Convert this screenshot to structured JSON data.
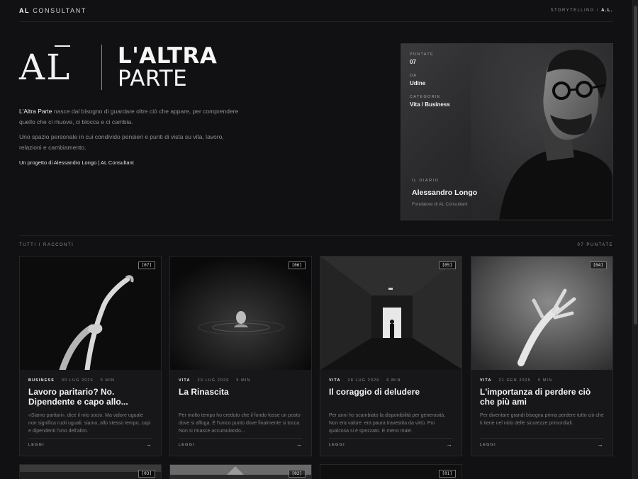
{
  "topbar": {
    "brand_bold": "AL",
    "brand_rest": "CONSULTANT",
    "nav_link": "STORYTELLING",
    "nav_separator": "/",
    "nav_current": "A.L."
  },
  "hero": {
    "logo_mark": "AL",
    "title_line1": "L'ALTRA",
    "title_line2": "PARTE",
    "intro_strong": "L'Altra Parte",
    "intro_rest": " nasce dal bisogno di guardare oltre ciò che appare, per comprendere quello che ci muove, ci blocca e ci cambia.",
    "intro_p2": "Uno spazio personale in cui condivido pensieri e punti di vista su vita, lavoro, relazioni e cambiamento.",
    "credit": "Un progetto di Alessandro Longo | AL Consultant"
  },
  "profile": {
    "episodes_label": "PUNTATE",
    "episodes_value": "07",
    "from_label": "DA",
    "from_value": "Udine",
    "categories_label": "CATEGORIE",
    "categories_value": "Vita / Business",
    "diary_label": "IL DIARIO",
    "name": "Alessandro Longo",
    "role": "Fondatore di AL Consultant"
  },
  "section": {
    "title": "TUTTI I RACCONTI",
    "count": "07 PUNTATE"
  },
  "cards": [
    {
      "badge": "[07]",
      "category": "BUSINESS",
      "date": "30 LUG 2026",
      "read": "5 MIN",
      "title": "Lavoro paritario? No. Dipendente e capo allo...",
      "excerpt": "«Siamo paritari», dice il mio socio. Ma valore uguale non significa ruoli uguali: siamo, allo stesso tempo, capi e dipendenti l'uno dell'altro.",
      "cta": "LEGGI",
      "arrow": "→"
    },
    {
      "badge": "[06]",
      "category": "VITA",
      "date": "29 LUG 2026",
      "read": "5 MIN",
      "title": "La Rinascita",
      "excerpt": "Per molto tempo ho creduto che il fondo fosse un posto dove si affoga. È l'unico punto dove finalmente si tocca. Non si rinasce accumulando...",
      "cta": "LEGGI",
      "arrow": "→"
    },
    {
      "badge": "[05]",
      "category": "VITA",
      "date": "28 LUG 2026",
      "read": "6 MIN",
      "title": "Il coraggio di deludere",
      "excerpt": "Per anni ho scambiato la disponibilità per generosità. Non era valore: era paura travestita da virtù. Poi qualcosa si è spezzato. E meno male.",
      "cta": "LEGGI",
      "arrow": "→"
    },
    {
      "badge": "[04]",
      "category": "VITA",
      "date": "21 GEN 2025",
      "read": "5 MIN",
      "title": "L'importanza di perdere ciò che più ami",
      "excerpt": "Per diventare grandi bisogna prima perdere tutto ciò che ti tiene nel nido delle sicurezze primordiali.",
      "cta": "LEGGI",
      "arrow": "→"
    }
  ],
  "partial_cards": [
    {
      "badge": "[03]"
    },
    {
      "badge": "[02]"
    },
    {
      "badge": "[01]"
    }
  ]
}
